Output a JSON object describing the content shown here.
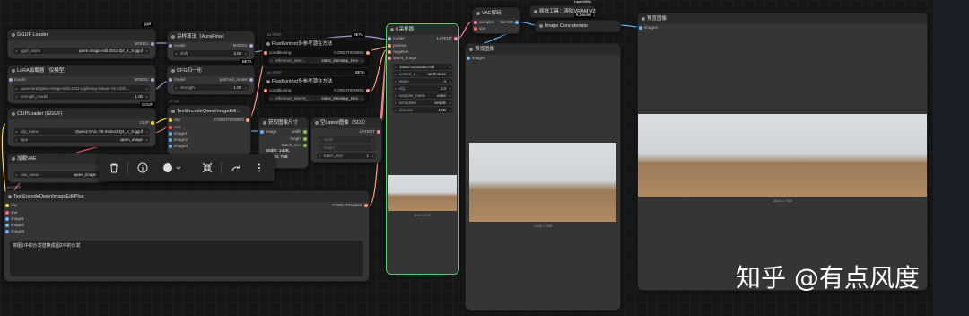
{
  "nodes": {
    "gguf_loader": {
      "title": "GGUF Loader",
      "model_out": "MODEL",
      "widget_key": "gguf_name",
      "widget_val": "qwen-image-edit-2511-Q4_K_S.gguf",
      "tag": "gguf"
    },
    "lora_loader": {
      "title": "LoRA加载器（仅模型）",
      "model_in": "model",
      "model_out": "MODEL",
      "lora_name": "qwen-lora\\Qwen-Image-Edit-2511-Lightning-4steps-V1.0-bf1...",
      "strength_key": "strength_model",
      "strength_val": "1.00"
    },
    "clip_loader": {
      "title": "CLIPLoader (GGUF)",
      "clip_out": "CLIP",
      "clip_key": "clip_name",
      "clip_val": "Qwen2.5-VL-7B-Instruct-Q4_K_S.gguf",
      "type_key": "type",
      "type_val": "qwen_image",
      "tag": "GGUF"
    },
    "vae_loader": {
      "title": "加载VAE",
      "vae_key": "vae_name",
      "vae_val": "qwen_image"
    },
    "sampling_alg": {
      "title": "采样算法（AuraFlow）",
      "model_in": "model",
      "model_out": "MODEL",
      "shift_key": "shift",
      "shift_val": "3.00"
    },
    "cfg_norm": {
      "title": "CFG归一化",
      "model_in": "model",
      "out": "patched_model",
      "strength_key": "strength",
      "strength_val": "1.00",
      "badge": "BETA"
    },
    "text_encode_1": {
      "title": "TextEncodeQwenImageEdi...",
      "inputs": [
        "clip",
        "vae",
        "image1",
        "image2",
        "image3"
      ],
      "output": "CONDITIONING",
      "tag": "#1 VAE"
    },
    "flux_ref_1": {
      "title": "FluxKontext多参考潜在方法",
      "badge": "BETA",
      "in": "conditioning",
      "out": "CONDITIONING",
      "w_key": "reference_laten...",
      "w_val": "index_timestep_zero",
      "tag": "#1 STEP"
    },
    "flux_ref_2": {
      "title": "FluxKontext多参考潜在方法",
      "badge": "BETA",
      "in": "conditioning",
      "out": "CONDITIONING",
      "w_key": "reference_latents_...",
      "w_val": "index_timestep_zero",
      "tag": "#1 STEP"
    },
    "get_size": {
      "title": "获取图像尺寸",
      "in": "image",
      "outs": [
        "width",
        "height",
        "batch_size"
      ],
      "preview_w": "Width: 1408,",
      "preview_h": "Height: 768"
    },
    "empty_latent": {
      "title": "空Latent图像（SD3）",
      "out": "LATENT",
      "width": "width",
      "height": "height",
      "batch_key": "batch_size",
      "batch_val": "1"
    },
    "ksampler": {
      "title": "K采样器",
      "inputs": [
        "model",
        "positive",
        "negative",
        "latent_image"
      ],
      "output": "LATENT",
      "seed": "1069734020250758",
      "control": "randomize",
      "control_key": "control_a...",
      "steps_key": "steps",
      "steps_val": "4",
      "cfg_key": "cfg",
      "cfg_val": "1.0",
      "sampler_key": "sampler_name",
      "sampler_val": "euler",
      "scheduler_key": "scheduler",
      "scheduler_val": "simple",
      "denoise_key": "denoise",
      "denoise_val": "1.00",
      "img_caption": "512 × 279"
    },
    "vae_decode": {
      "title": "VAE解码",
      "inputs": [
        "samples",
        "vae"
      ],
      "output": "IMAGE"
    },
    "release_vram": {
      "title": "释放工具：清除VRAM V2",
      "tag1": "LayerUtility",
      "tag2": "KJNodes"
    },
    "image_concat": {
      "title": "Image Concatenate"
    },
    "preview_small": {
      "title": "预览图像",
      "in": "images",
      "caption": "1408 × 768"
    },
    "preview_big": {
      "title": "预览图像",
      "in": "images",
      "caption": "2816 × 768"
    },
    "text_encode_plus": {
      "title": "TextEncodeQwenImageEditPlus",
      "inputs": [
        "clip",
        "vae",
        "image1",
        "image2",
        "image3"
      ],
      "output": "CONDITIONING",
      "prompt": "将图1中的沙发替换成图2中的沙发",
      "tag": "#1 STEP"
    }
  },
  "toolbar": {
    "icons": [
      "trash-icon",
      "info-icon",
      "color-circle-icon",
      "shrink-icon",
      "redo-icon",
      "more-icon"
    ]
  },
  "watermark": "知乎 @有点风度"
}
